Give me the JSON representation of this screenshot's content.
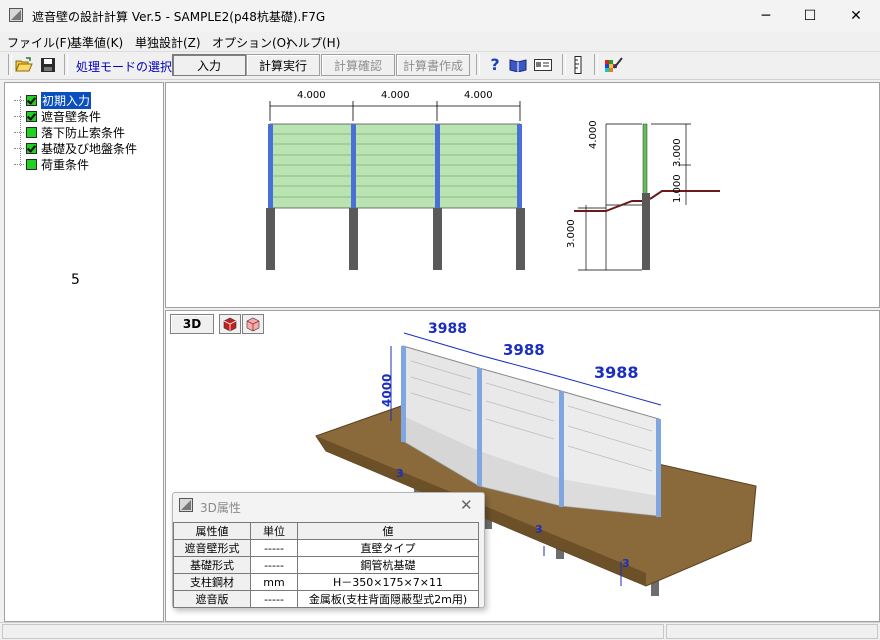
{
  "window": {
    "title": "遮音壁の設計計算 Ver.5 - SAMPLE2(p48杭基礎).F7G",
    "minimize": "─",
    "maximize": "☐",
    "close": "✕"
  },
  "menu": [
    {
      "label": "ファイル(F)"
    },
    {
      "label": "基準値(K)"
    },
    {
      "label": "単独設計(Z)"
    },
    {
      "label": "オプション(O)"
    },
    {
      "label": "ヘルプ(H)"
    }
  ],
  "toolbar": {
    "mode_label": "処理モードの選択",
    "mode_value": "入力",
    "run_label": "計算実行",
    "confirm_label": "計算確認",
    "report_label": "計算書作成"
  },
  "tree": {
    "items": [
      {
        "label": "初期入力",
        "checked": true
      },
      {
        "label": "遮音壁条件",
        "checked": true
      },
      {
        "label": "落下防止索条件",
        "checked": false
      },
      {
        "label": "基礎及び地盤条件",
        "checked": true
      },
      {
        "label": "荷重条件",
        "checked": false
      }
    ],
    "overlay_number": "5"
  },
  "drawing_2d": {
    "spans": [
      "4.000",
      "4.000",
      "4.000"
    ],
    "section_dims": {
      "wall_height": "4.000",
      "pile_length": "3.000",
      "upper": "3.000",
      "offset": "1.000"
    }
  },
  "view_3d": {
    "button_label": "3D",
    "spans": [
      "3988",
      "3988",
      "3988"
    ],
    "height": "4000",
    "pile_label": "3"
  },
  "props_dialog": {
    "title": "3D属性",
    "close": "✕",
    "headers": [
      "属性値",
      "単位",
      "値"
    ],
    "rows": [
      {
        "name": "遮音壁形式",
        "unit": "-----",
        "value": "直壁タイプ"
      },
      {
        "name": "基礎形式",
        "unit": "-----",
        "value": "鋼管杭基礎"
      },
      {
        "name": "支柱鋼材",
        "unit": "mm",
        "value": "H－350×175×7×11"
      },
      {
        "name": "遮音版",
        "unit": "-----",
        "value": "金属板(支柱背面隠蔽型式2m用)"
      }
    ]
  },
  "colors": {
    "panel_green": "#b9e3b1",
    "post_blue": "#4a6fd6",
    "pile_gray": "#5a5a5a",
    "ground_brown": "#8a6a3a",
    "dim_blue": "#1a2fbf"
  }
}
